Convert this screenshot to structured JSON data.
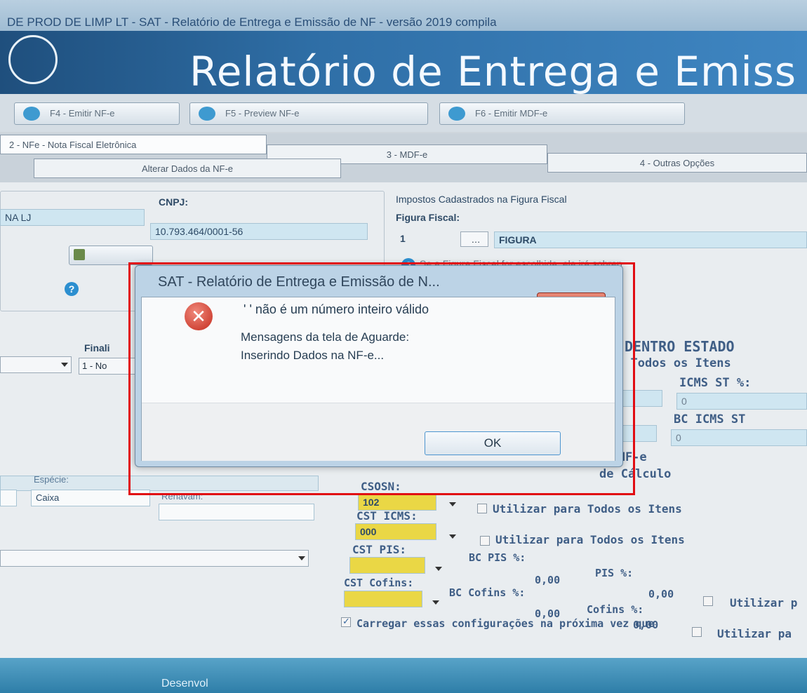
{
  "window": {
    "title": "DE PROD DE LIMP LT - SAT - Relatório de Entrega e Emissão de NF - versão 2019 compila"
  },
  "banner": {
    "title": "Relatório de Entrega e Emiss"
  },
  "toolbar": {
    "btn_f4": "F4 - Emitir NF-e",
    "btn_f5": "F5 - Preview NF-e",
    "btn_f6": "F6 - Emitir MDF-e"
  },
  "tabs": {
    "tab2": "2 - NFe - Nota Fiscal Eletrônica",
    "tab3": "3 - MDF-e",
    "tab4": "4 - Outras Opções",
    "subtab": "Alterar Dados da NF-e"
  },
  "form": {
    "name_value": "NA LJ",
    "cnpj_label": "CNPJ:",
    "cnpj_value": "10.793.464/0001-56",
    "impostos_label": "Impostos Cadastrados na Figura Fiscal",
    "figura_label": "Figura Fiscal:",
    "figura_num": "1",
    "figura_value": "FIGURA",
    "figura_hint": "Se a Figura Fiscal for escolhida, ela irá sobrep",
    "finalidade_label": "Finali",
    "finalidade_value": "1 - No",
    "dentro_estado": "DENTRO ESTADO",
    "todos_itens": "a Todos os Itens",
    "icms_st_label": "ICMS ST %:",
    "icms_st_value": "0",
    "bc_icms_st_label": "BC ICMS ST",
    "bc_icms_st_value": "0",
    "na_nfe": "na NF-e",
    "de_calculo": "de Cálculo",
    "especie_label": "Espécie:",
    "especie_value": "Caixa",
    "renavam_label": "Renavam:",
    "csosn_label": "CSOSN:",
    "csosn_value": "102",
    "utilizar1": "Utilizar para Todos os Itens",
    "cst_icms_label": "CST ICMS:",
    "cst_icms_value": "000",
    "utilizar2": "Utilizar para Todos os Itens",
    "cst_pis_label": "CST PIS:",
    "bc_pis_label": "BC PIS %:",
    "bc_pis_value": "0,00",
    "pis_label": "PIS %:",
    "pis_value": "0,00",
    "utilizar3": "Utilizar p",
    "cst_cofins_label": "CST Cofins:",
    "bc_cofins_label": "BC Cofins %:",
    "bc_cofins_value": "0,00",
    "cofins_label": "Cofins %:",
    "cofins_value": "0,00",
    "utilizar4": "Utilizar pa",
    "carregar": "Carregar essas configurações na próxima vez que"
  },
  "dialog": {
    "title": "SAT - Relatório de Entrega e Emissão de N...",
    "close": "X",
    "message": "' ' não é um número inteiro válido",
    "line2": "Mensagens da tela de Aguarde:",
    "line3": "Inserindo Dados na NF-e...",
    "ok": "OK"
  },
  "status": {
    "text": "Desenvol"
  }
}
